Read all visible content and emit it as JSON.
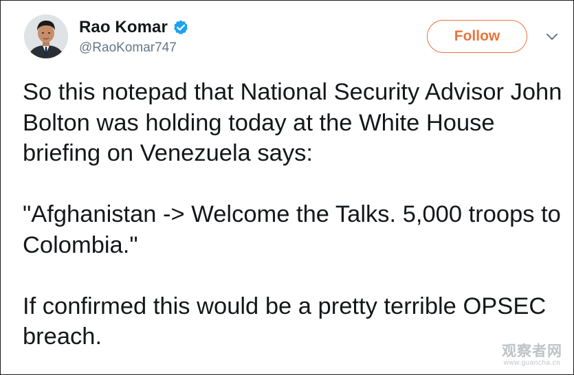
{
  "tweet": {
    "display_name": "Rao Komar",
    "handle": "@RaoKomar747",
    "verified": true,
    "follow_label": "Follow",
    "paragraphs": [
      "So this notepad that National Security Advisor John Bolton was holding today at the White House briefing on Venezuela says:",
      "\"Afghanistan -> Welcome the Talks. 5,000 troops to Colombia.\"",
      "If confirmed this would be a pretty terrible OPSEC breach."
    ]
  },
  "watermark": {
    "main": "观察者网",
    "url": "www.guancha.cn"
  },
  "icons": {
    "verified": "verified-badge-icon",
    "caret": "chevron-down-icon"
  },
  "colors": {
    "accent": "#e8743b",
    "verified": "#1da1f2",
    "text": "#14171a",
    "muted": "#657786"
  }
}
